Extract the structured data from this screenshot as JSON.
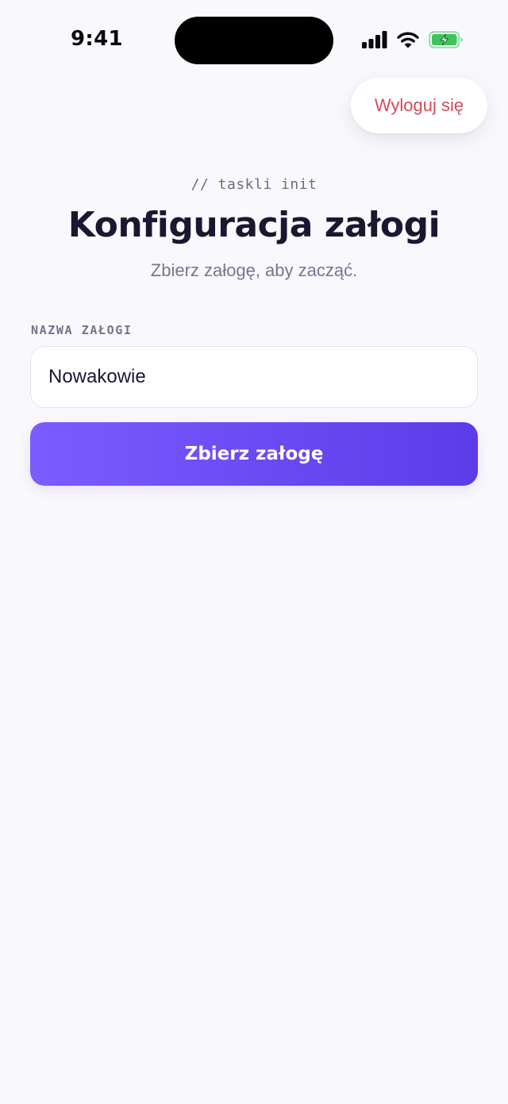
{
  "status_bar": {
    "time": "9:41",
    "icons": [
      "cellular-signal-icon",
      "wifi-icon",
      "battery-charging-icon"
    ],
    "battery_color": "#3fc45c"
  },
  "header": {
    "logout_label": "Wyloguj się",
    "eyebrow": "// taskli init",
    "title": "Konfiguracja załogi",
    "subtitle": "Zbierz załogę, aby zacząć."
  },
  "form": {
    "field_label": "NAZWA ZAŁOGI",
    "field_value": "Nowakowie",
    "submit_label": "Zbierz załogę"
  },
  "colors": {
    "accent_start": "#7b5cff",
    "accent_end": "#5b3ce8",
    "danger": "#d64a58",
    "background": "#f9f9fd"
  }
}
